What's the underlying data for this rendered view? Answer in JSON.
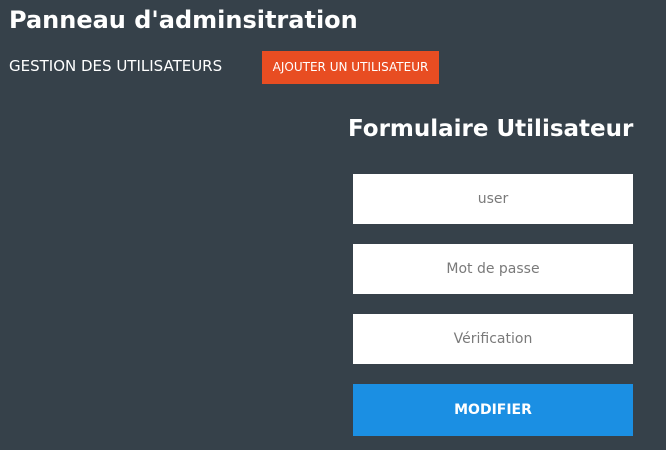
{
  "header": {
    "title": "Panneau d'adminsitration"
  },
  "nav": {
    "section_label": "GESTION DES UTILISATEURS",
    "add_user_label": "AJOUTER UN UTILISATEUR"
  },
  "form": {
    "title": "Formulaire Utilisateur",
    "user_field": {
      "value": "",
      "placeholder": "user"
    },
    "password_field": {
      "value": "",
      "placeholder": "Mot de passe"
    },
    "verification_field": {
      "value": "",
      "placeholder": "Vérification"
    },
    "submit_label": "MODIFIER"
  },
  "colors": {
    "background": "#36414a",
    "add_button": "#e84d22",
    "submit_button": "#1b8fe3"
  }
}
